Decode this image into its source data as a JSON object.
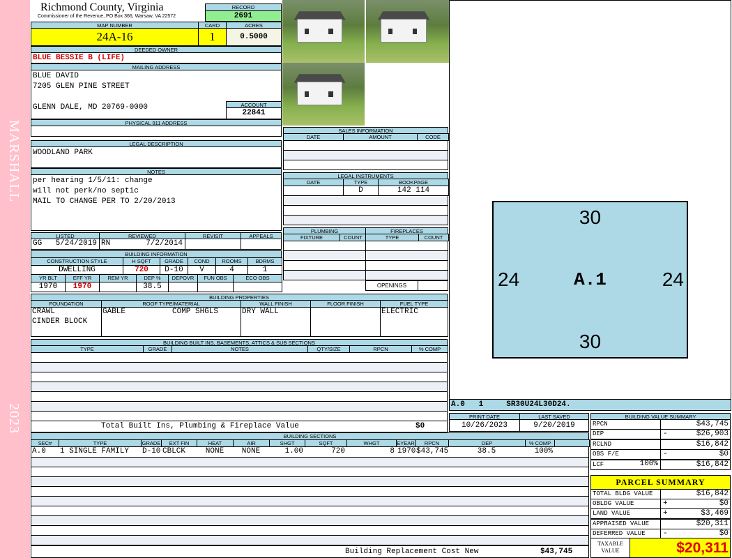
{
  "strip": {
    "owner_last": "MARSHALL",
    "year": "2023"
  },
  "header": {
    "county": "Richmond County, Virginia",
    "office": "Commissioner of the Revenue, PO Box 366, Warsaw, VA 22572",
    "record_label": "RECORD",
    "record": "2691"
  },
  "parcel": {
    "map_label": "MAP NUMBER",
    "map": "24A-16",
    "card_label": "CARD",
    "card": "1",
    "acres_label": "ACRES",
    "acres": "0.5000"
  },
  "owner": {
    "label": "DEEDED OWNER",
    "name": "BLUE BESSIE B (LIFE)"
  },
  "mailing": {
    "label": "MAILING ADDRESS",
    "line1": "BLUE DAVID",
    "line2": "7205 GLEN PINE STREET",
    "line3": "GLENN DALE, MD 20769-0000",
    "account_label": "ACCOUNT",
    "account": "22841"
  },
  "physical": {
    "label": "PHYSICAL 911 ADDRESS",
    "value": ""
  },
  "legal": {
    "label": "LEGAL DESCRIPTION",
    "value": "WOODLAND PARK"
  },
  "notes": {
    "label": "NOTES",
    "line1": "per hearing 1/5/11: change",
    "line2": "will not perk/no septic",
    "line3": "MAIL TO CHANGE PER TO 2/20/2013"
  },
  "review": {
    "listed_label": "LISTED",
    "reviewed_label": "REVIEWED",
    "revisit_label": "REVISIT",
    "appeals_label": "APPEALS",
    "listed_by": "GG",
    "listed_date": "5/24/2019",
    "reviewed_by": "RN",
    "reviewed_date": "7/2/2014"
  },
  "bldg_info": {
    "label": "BUILDING INFORMATION",
    "h": [
      "CONSTRUCTION STYLE",
      "H SQFT",
      "GRADE",
      "COND",
      "ROOMS",
      "BDRMS"
    ],
    "v": [
      "DWELLING",
      "720",
      "D-10",
      "V",
      "4",
      "1"
    ],
    "h2": [
      "YR BLT",
      "EFF YR",
      "REM YR",
      "DEP %",
      "DEPOVR",
      "FUN OBS",
      "ECO OBS"
    ],
    "v2": [
      "1970",
      "1970",
      "",
      "38.5",
      "",
      "",
      ""
    ]
  },
  "sales": {
    "label": "SALES INFORMATION",
    "h": [
      "DATE",
      "AMOUNT",
      "CODE"
    ]
  },
  "instruments": {
    "label": "LEGAL INSTRUMENTS",
    "h": [
      "DATE",
      "TYPE",
      "BOOKPAGE"
    ],
    "row": [
      "",
      "D",
      "142 114"
    ]
  },
  "plumbing": {
    "label": "PLUMBING",
    "h": [
      "FIXTURE",
      "COUNT"
    ]
  },
  "fireplaces": {
    "label": "FIREPLACES",
    "h": [
      "TYPE",
      "COUNT"
    ],
    "openings": "OPENINGS"
  },
  "props": {
    "label": "BUILDING PROPERTIES",
    "h": [
      "FOUNDATION",
      "ROOF TYPE/MATERIAL",
      "WALL FINISH",
      "FLOOR FINISH",
      "FUEL TYPE"
    ],
    "foundation1": "CRAWL",
    "foundation2": "CINDER BLOCK",
    "roof_type": "GABLE",
    "roof_mat": "COMP SHGLS",
    "wall": "DRY WALL",
    "floor": "",
    "fuel": "ELECTRIC"
  },
  "builtins": {
    "label": "BUILDING BUILT INS, BASEMENTS, ATTICS & SUB SECTIONS",
    "h": [
      "TYPE",
      "GRADE",
      "NOTES",
      "QTY/SIZE",
      "RPCN",
      "% COMP"
    ],
    "total_label": "Total Built Ins, Plumbing & Fireplace Value",
    "total": "$0"
  },
  "sketch": {
    "top": "30",
    "bottom": "30",
    "left": "24",
    "right": "24",
    "center": "A.1",
    "code": "A.0   1     SR30U24L30D24."
  },
  "dates": {
    "print_label": "PRINT DATE",
    "print": "10/26/2023",
    "saved_label": "LAST SAVED",
    "saved": "9/20/2019"
  },
  "sections": {
    "label": "BUILDING SECTIONS",
    "h": [
      "SEC#",
      "TYPE",
      "GRADE",
      "EXT FIN",
      "HEAT",
      "AIR",
      "SHGT",
      "SQFT",
      "WHGT",
      "EYEAR",
      "RPCN",
      "DEP",
      "% COMP"
    ],
    "row": [
      "A.0",
      "1 SINGLE FAMILY",
      "D-10",
      "CBLCK",
      "NONE",
      "NONE",
      "1.00",
      "720",
      "8",
      "1970",
      "$43,745",
      "38.5",
      "100%"
    ],
    "rcn_label": "Building Replacement Cost New",
    "rcn": "$43,745"
  },
  "value_summary": {
    "label": "BUILDING VALUE SUMMARY",
    "rpcn_l": "RPCN",
    "rpcn": "$43,745",
    "dep_l": "DEP",
    "dep_op": "-",
    "dep": "$26,903",
    "rclnd_l": "RCLND",
    "rclnd": "$16,842",
    "obs_l": "OBS F/E",
    "obs_op": "-",
    "obs": "$0",
    "lcf_l": "LCF",
    "lcf_pct": "100%",
    "lcf": "$16,842"
  },
  "parcel_summary": {
    "label": "PARCEL SUMMARY",
    "total_bldg_l": "TOTAL BLDG VALUE",
    "total_bldg": "$16,842",
    "obldg_l": "OBLDG VALUE",
    "obldg_op": "+",
    "obldg": "$0",
    "land_l": "LAND VALUE",
    "land_op": "+",
    "land": "$3,469",
    "appraised_l": "APPRAISED VALUE",
    "appraised": "$20,311",
    "deferred_l": "DEFERRED VALUE",
    "deferred_op": "-",
    "deferred": "$0",
    "taxable_l1": "TAXABLE",
    "taxable_l2": "VALUE",
    "taxable": "$20,311"
  }
}
